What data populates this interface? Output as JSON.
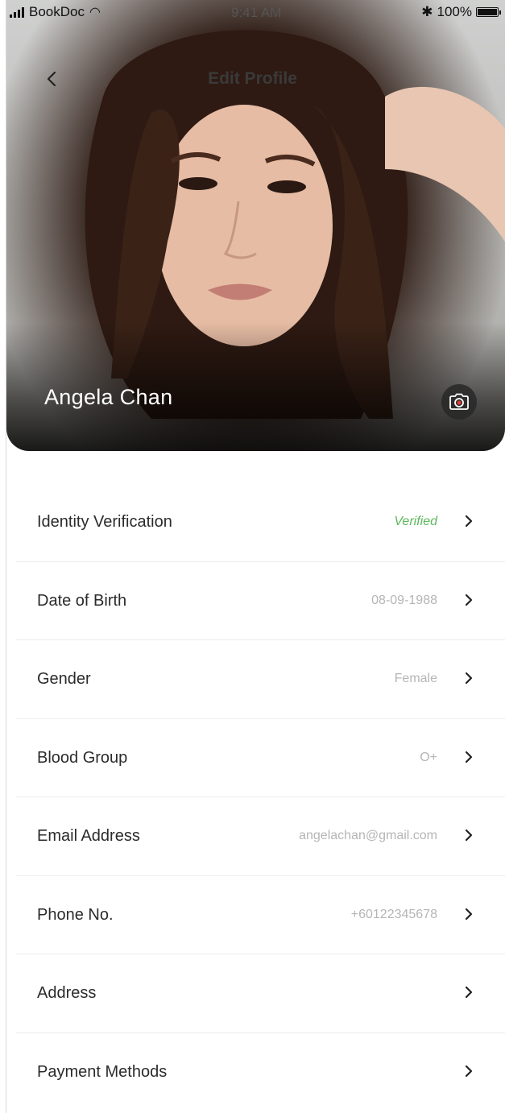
{
  "status_bar": {
    "carrier": "BookDoc",
    "time": "9:41 AM",
    "battery": "100%",
    "icons": [
      "signal-icon",
      "wifi-icon",
      "bluetooth-icon",
      "battery-icon"
    ]
  },
  "header": {
    "back_icon": "chevron-left-icon",
    "title": "Edit Profile"
  },
  "profile": {
    "name": "Angela Chan",
    "camera_icon": "camera-icon"
  },
  "colors": {
    "verified": "#5cb85c",
    "value_text": "#b5b5b5",
    "label_text": "#2b2b2b"
  },
  "settings": [
    {
      "label": "Identity Verification",
      "value": "Verified",
      "status": "verified"
    },
    {
      "label": "Date of Birth",
      "value": "08-09-1988"
    },
    {
      "label": "Gender",
      "value": "Female"
    },
    {
      "label": "Blood Group",
      "value": "O+"
    },
    {
      "label": "Email Address",
      "value": "angelachan@gmail.com"
    },
    {
      "label": "Phone No.",
      "value": "+60122345678"
    },
    {
      "label": "Address",
      "value": ""
    },
    {
      "label": "Payment Methods",
      "value": ""
    }
  ]
}
